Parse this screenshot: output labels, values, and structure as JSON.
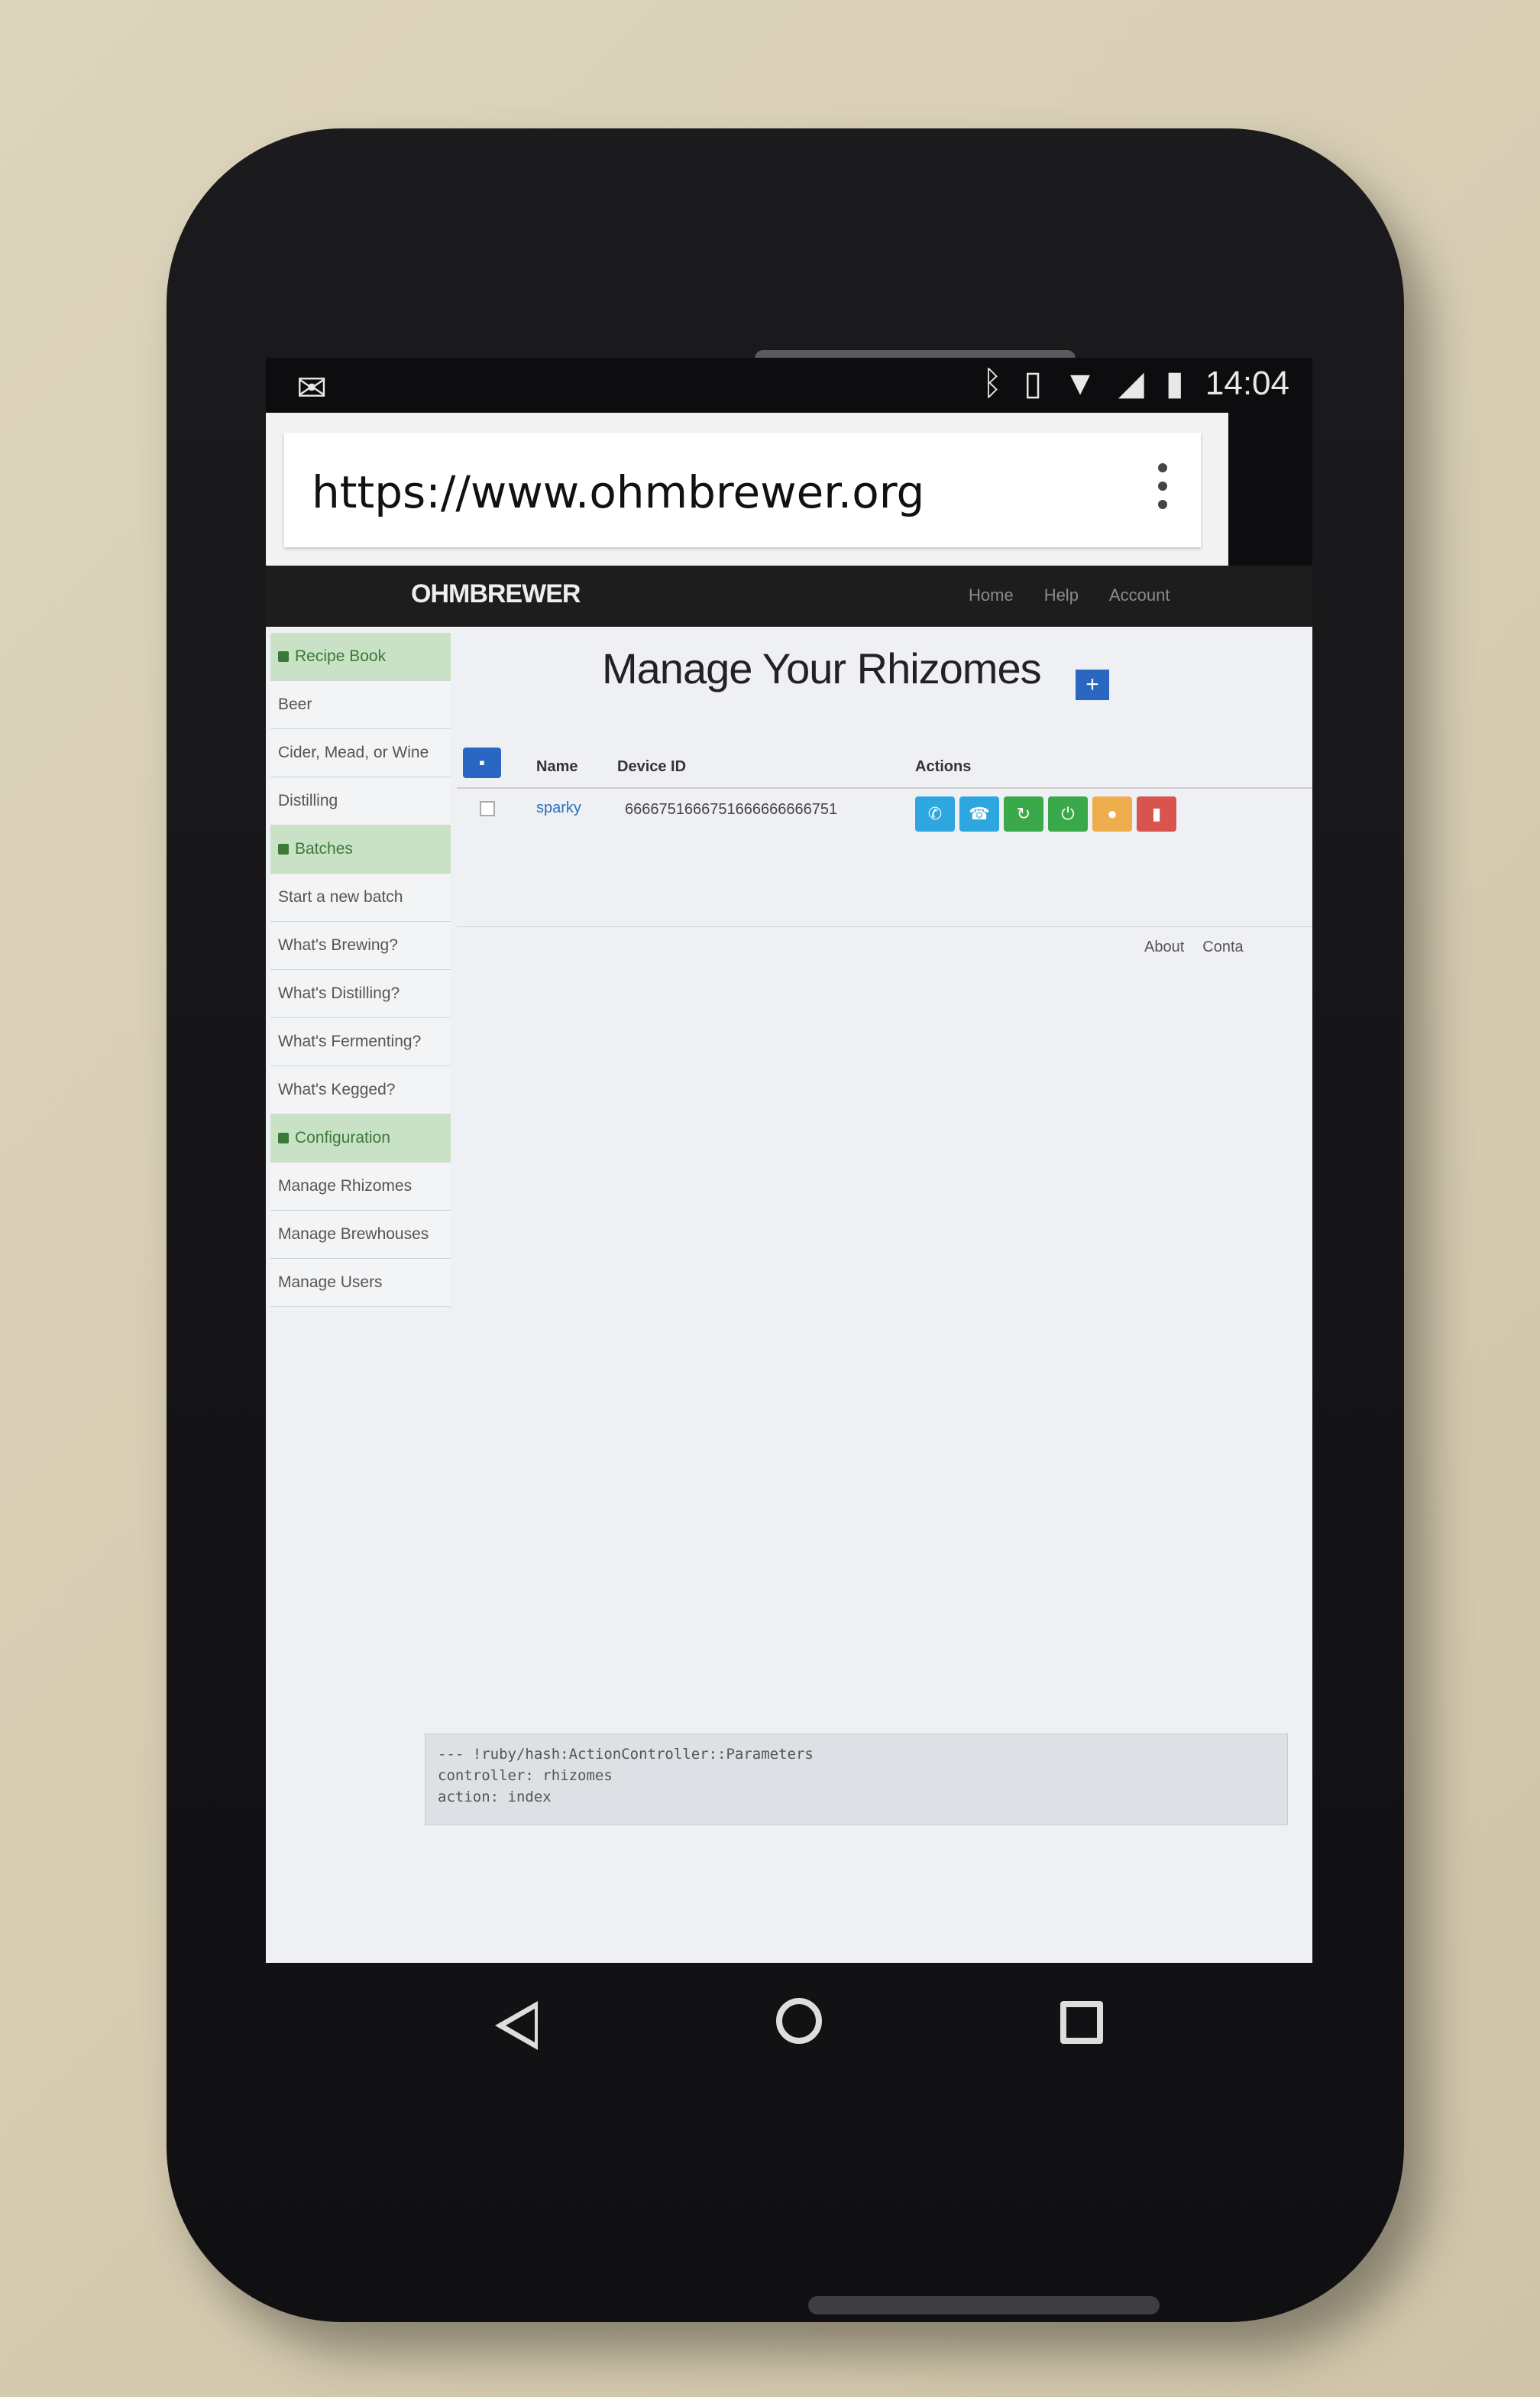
{
  "status_bar": {
    "time": "14:04"
  },
  "browser": {
    "url": "https://www.ohmbrewer.org"
  },
  "navbar": {
    "brand": "OHMBREWER",
    "links": [
      "Home",
      "Help",
      "Account"
    ]
  },
  "sidebar": {
    "sections": [
      {
        "header": "Recipe Book",
        "items": [
          "Beer",
          "Cider, Mead, or Wine",
          "Distilling"
        ]
      },
      {
        "header": "Batches",
        "items": [
          "Start a new batch",
          "What's Brewing?",
          "What's Distilling?",
          "What's Fermenting?",
          "What's Kegged?"
        ]
      },
      {
        "header": "Configuration",
        "items": [
          "Manage Rhizomes",
          "Manage Brewhouses",
          "Manage Users"
        ]
      }
    ]
  },
  "main": {
    "title": "Manage Your Rhizomes",
    "table": {
      "headers": [
        "Name",
        "Device ID",
        "Actions"
      ],
      "rows": [
        {
          "name": "sparky",
          "device_id": "6666751666751666666666751"
        }
      ]
    },
    "action_colors": [
      "#2ea7e0",
      "#2ea7e0",
      "#3aa94a",
      "#3aa94a",
      "#f0ad4e",
      "#d9534f"
    ],
    "footer": [
      "About",
      "Conta"
    ]
  },
  "debug": {
    "lines": [
      "--- !ruby/hash:ActionController::Parameters",
      "controller: rhizomes",
      "action: index"
    ]
  }
}
